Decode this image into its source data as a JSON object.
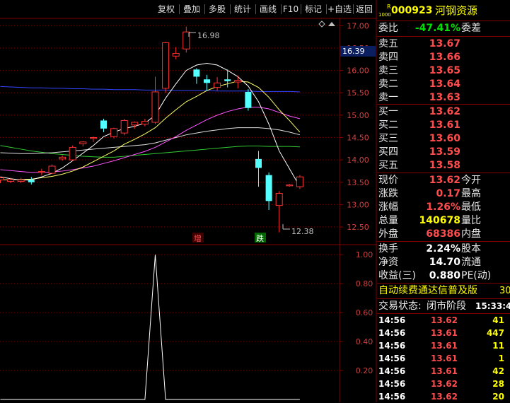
{
  "toolbar": {
    "buttons": [
      "复权",
      "叠加",
      "多股",
      "统计",
      "画线",
      "F10",
      "标记",
      "+自选",
      "返回"
    ]
  },
  "stock": {
    "badge_top": "R",
    "badge_bottom": "1000",
    "code": "000923",
    "name": "河钢资源"
  },
  "price_tag": "16.39",
  "chart": {
    "y_axis_labels": [
      "17.00",
      "16.50",
      "16.00",
      "15.50",
      "15.00",
      "14.50",
      "14.00",
      "13.50",
      "13.00",
      "12.50"
    ],
    "high_label": "16.98",
    "low_label": "12.38",
    "increase_label": "增",
    "decrease_label": "跌",
    "indicator_labels": [
      "1.00",
      "0.80",
      "0.60",
      "0.40",
      "0.20"
    ],
    "colors": {
      "up": "#ff3333",
      "down": "#54ffff",
      "ma5": "#ffffff",
      "ma10": "#ffff66",
      "ma20": "#ff55ff",
      "ma30": "#e0e0e0",
      "ma60": "#33cc33",
      "ma120": "#3344ff"
    }
  },
  "chart_data": {
    "type": "candlestick",
    "ylim": [
      12.2,
      17.1
    ],
    "candles": [
      {
        "o": 13.55,
        "h": 13.62,
        "l": 13.48,
        "c": 13.6
      },
      {
        "o": 13.52,
        "h": 13.6,
        "l": 13.48,
        "c": 13.56
      },
      {
        "o": 13.52,
        "h": 13.6,
        "l": 13.48,
        "c": 13.55
      },
      {
        "o": 13.55,
        "h": 13.62,
        "l": 13.45,
        "c": 13.5
      },
      {
        "o": 13.72,
        "h": 13.8,
        "l": 13.65,
        "c": 13.74
      },
      {
        "o": 13.7,
        "h": 13.9,
        "l": 13.68,
        "c": 13.86
      },
      {
        "o": 14.02,
        "h": 14.1,
        "l": 13.98,
        "c": 14.06
      },
      {
        "o": 14.0,
        "h": 14.32,
        "l": 13.98,
        "c": 14.28
      },
      {
        "o": 14.36,
        "h": 14.42,
        "l": 14.3,
        "c": 14.4
      },
      {
        "o": 14.48,
        "h": 14.52,
        "l": 14.4,
        "c": 14.5
      },
      {
        "o": 14.88,
        "h": 14.92,
        "l": 14.62,
        "c": 14.7
      },
      {
        "o": 14.52,
        "h": 14.72,
        "l": 14.48,
        "c": 14.7
      },
      {
        "o": 14.6,
        "h": 14.92,
        "l": 14.55,
        "c": 14.88
      },
      {
        "o": 14.78,
        "h": 14.86,
        "l": 14.7,
        "c": 14.84
      },
      {
        "o": 14.8,
        "h": 14.92,
        "l": 14.75,
        "c": 14.86
      },
      {
        "o": 14.84,
        "h": 15.86,
        "l": 14.8,
        "c": 15.52
      },
      {
        "o": 15.6,
        "h": 16.64,
        "l": 15.5,
        "c": 16.62
      },
      {
        "o": 16.32,
        "h": 16.52,
        "l": 16.25,
        "c": 16.38
      },
      {
        "o": 16.48,
        "h": 16.98,
        "l": 16.4,
        "c": 16.86
      },
      {
        "o": 16.02,
        "h": 16.05,
        "l": 15.7,
        "c": 15.86
      },
      {
        "o": 15.8,
        "h": 15.9,
        "l": 15.55,
        "c": 15.72
      },
      {
        "o": 15.62,
        "h": 15.85,
        "l": 15.55,
        "c": 15.72
      },
      {
        "o": 15.8,
        "h": 16.02,
        "l": 15.62,
        "c": 15.76
      },
      {
        "o": 15.74,
        "h": 15.88,
        "l": 15.6,
        "c": 15.78
      },
      {
        "o": 15.52,
        "h": 15.58,
        "l": 15.1,
        "c": 15.16
      },
      {
        "o": 14.02,
        "h": 14.2,
        "l": 13.4,
        "c": 13.82
      },
      {
        "o": 13.66,
        "h": 13.72,
        "l": 12.88,
        "c": 13.08
      },
      {
        "o": 12.98,
        "h": 13.3,
        "l": 12.38,
        "c": 13.25
      },
      {
        "o": 13.42,
        "h": 13.46,
        "l": 13.4,
        "c": 13.44
      },
      {
        "o": 13.4,
        "h": 13.66,
        "l": 13.35,
        "c": 13.62
      }
    ],
    "ma5": [
      13.62,
      13.58,
      13.55,
      13.55,
      13.62,
      13.7,
      13.82,
      13.98,
      14.15,
      14.32,
      14.52,
      14.62,
      14.7,
      14.75,
      14.82,
      15.0,
      15.38,
      15.7,
      16.0,
      16.12,
      16.16,
      16.12,
      16.0,
      15.86,
      15.65,
      15.3,
      14.8,
      14.2,
      13.8,
      13.4
    ],
    "ma10": [
      13.55,
      13.56,
      13.56,
      13.57,
      13.6,
      13.63,
      13.68,
      13.75,
      13.84,
      13.96,
      14.08,
      14.2,
      14.35,
      14.46,
      14.58,
      14.72,
      14.93,
      15.12,
      15.3,
      15.42,
      15.55,
      15.64,
      15.7,
      15.76,
      15.74,
      15.62,
      15.4,
      15.12,
      14.88,
      14.62
    ],
    "ma20": [
      13.78,
      13.76,
      13.74,
      13.72,
      13.72,
      13.73,
      13.75,
      13.78,
      13.82,
      13.86,
      13.92,
      13.98,
      14.05,
      14.12,
      14.19,
      14.28,
      14.4,
      14.52,
      14.66,
      14.78,
      14.9,
      15.0,
      15.08,
      15.14,
      15.18,
      15.18,
      15.14,
      15.06,
      14.98,
      14.92
    ],
    "ma30": [
      14.16,
      14.15,
      14.14,
      14.14,
      14.15,
      14.16,
      14.18,
      14.2,
      14.22,
      14.24,
      14.26,
      14.28,
      14.3,
      14.32,
      14.34,
      14.38,
      14.44,
      14.5,
      14.56,
      14.6,
      14.64,
      14.67,
      14.7,
      14.72,
      14.72,
      14.72,
      14.7,
      14.67,
      14.62,
      14.56
    ],
    "ma60": [
      14.32,
      14.28,
      14.24,
      14.2,
      14.17,
      14.14,
      14.12,
      14.1,
      14.08,
      14.07,
      14.06,
      14.06,
      14.08,
      14.1,
      14.12,
      14.14,
      14.16,
      14.18,
      14.2,
      14.22,
      14.24,
      14.26,
      14.28,
      14.3,
      14.31,
      14.31,
      14.3,
      14.3,
      14.3,
      14.29
    ],
    "ma120": [
      15.64,
      15.63,
      15.62,
      15.61,
      15.61,
      15.6,
      15.6,
      15.59,
      15.59,
      15.58,
      15.58,
      15.57,
      15.57,
      15.57,
      15.56,
      15.56,
      15.56,
      15.55,
      15.55,
      15.55,
      15.55,
      15.54,
      15.54,
      15.54,
      15.54,
      15.53,
      15.53,
      15.53,
      15.53,
      15.52
    ],
    "indicator": [
      0,
      0,
      0,
      0,
      0,
      0,
      0,
      0,
      0,
      0,
      0,
      0,
      0,
      0,
      0,
      0,
      0,
      0,
      0,
      0,
      0,
      0,
      0,
      0,
      0,
      0,
      0,
      0,
      0,
      0
    ],
    "indicator_peak_index": 15,
    "indicator_peak_value": 1.0,
    "indicator_ylim": [
      0,
      1.05
    ]
  },
  "quote": {
    "weibi": {
      "label": "委比",
      "value": "-47.41%",
      "label2": "委差"
    },
    "asks": [
      {
        "label": "卖五",
        "price": "13.67"
      },
      {
        "label": "卖四",
        "price": "13.66"
      },
      {
        "label": "卖三",
        "price": "13.65"
      },
      {
        "label": "卖二",
        "price": "13.64"
      },
      {
        "label": "卖一",
        "price": "13.63"
      }
    ],
    "bids": [
      {
        "label": "买一",
        "price": "13.62"
      },
      {
        "label": "买二",
        "price": "13.61"
      },
      {
        "label": "买三",
        "price": "13.60"
      },
      {
        "label": "买四",
        "price": "13.59"
      },
      {
        "label": "买五",
        "price": "13.58"
      }
    ],
    "stats": [
      {
        "label": "现价",
        "value": "13.62",
        "color": "red",
        "label2": "今开"
      },
      {
        "label": "涨跌",
        "value": "0.17",
        "color": "red",
        "label2": "最高"
      },
      {
        "label": "涨幅",
        "value": "1.26%",
        "color": "red",
        "label2": "最低"
      },
      {
        "label": "总量",
        "value": "140678",
        "color": "yellow",
        "label2": "量比"
      },
      {
        "label": "外盘",
        "value": "68386",
        "color": "red",
        "label2": "内盘"
      }
    ],
    "stats2": [
      {
        "label": "换手",
        "value": "2.24%",
        "label2": "股本"
      },
      {
        "label": "净资",
        "value": "14.70",
        "label2": "流通"
      },
      {
        "label": "收益(三)",
        "value": "0.880",
        "label2": "PE(动)"
      }
    ],
    "scroll_text": "自动续费通达信普及版",
    "scroll_tail": "30",
    "status_label": "交易状态:",
    "status_value": "闭市阶段",
    "status_time": "15:33:4",
    "trades": [
      {
        "time": "14:56",
        "price": "13.62",
        "vol": "41"
      },
      {
        "time": "14:56",
        "price": "13.61",
        "vol": "447"
      },
      {
        "time": "14:56",
        "price": "13.61",
        "vol": "11"
      },
      {
        "time": "14:56",
        "price": "13.61",
        "vol": "1"
      },
      {
        "time": "14:56",
        "price": "13.61",
        "vol": "42"
      },
      {
        "time": "14:56",
        "price": "13.62",
        "vol": "28"
      },
      {
        "time": "14:56",
        "price": "13.62",
        "vol": "20"
      }
    ]
  }
}
